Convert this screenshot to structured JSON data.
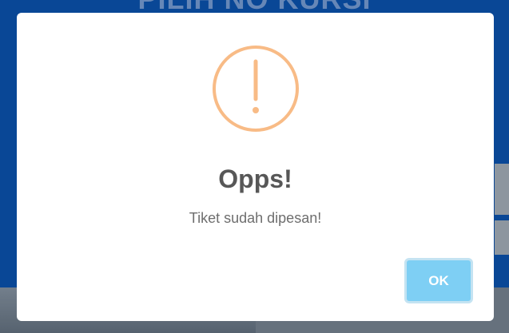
{
  "background": {
    "title": "PILIH NO KURSI"
  },
  "modal": {
    "icon": "exclamation-circle-icon",
    "icon_color": "#f8bb86",
    "title": "Opps!",
    "text": "Tiket sudah dipesan!",
    "ok_label": "OK",
    "ok_color": "#7ecff4"
  }
}
